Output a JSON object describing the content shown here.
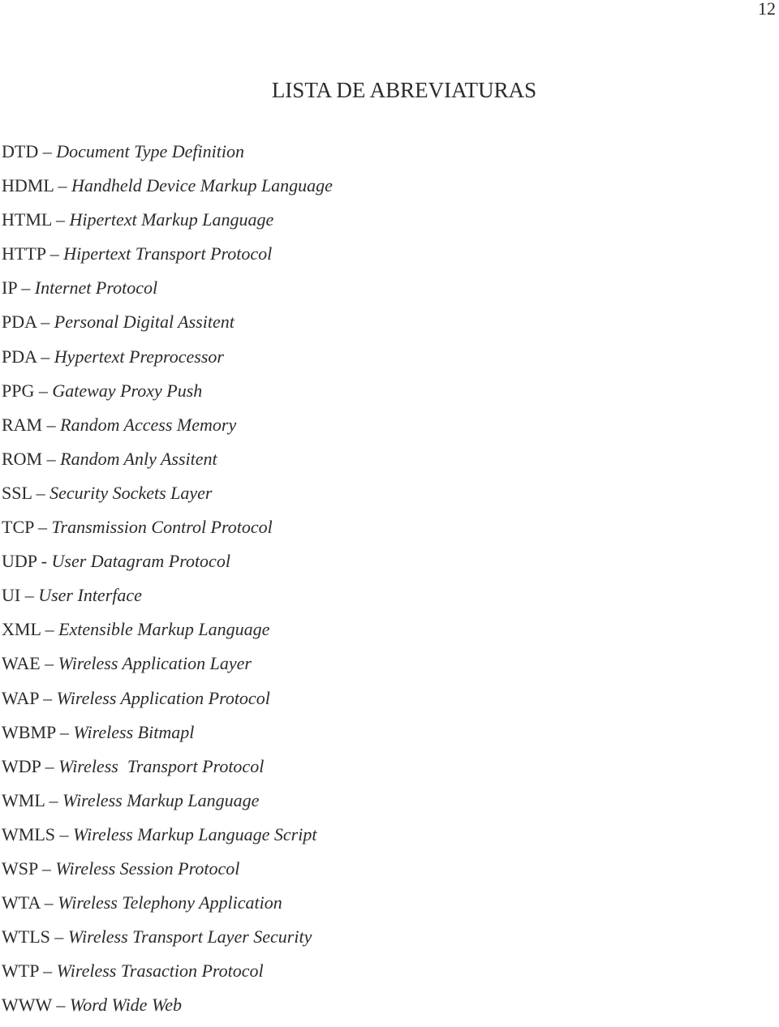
{
  "page": {
    "number": "12",
    "title": "LISTA DE ABREVIATURAS"
  },
  "abbreviations": [
    {
      "term": "DTD",
      "sep": " – ",
      "definition": "Document Type Definition"
    },
    {
      "term": "HDML",
      "sep": " – ",
      "definition": "Handheld Device Markup Language"
    },
    {
      "term": "HTML",
      "sep": " – ",
      "definition": "Hipertext Markup Language"
    },
    {
      "term": "HTTP",
      "sep": " – ",
      "definition": "Hipertext Transport Protocol"
    },
    {
      "term": "IP",
      "sep": " – ",
      "definition": "Internet Protocol"
    },
    {
      "term": "PDA",
      "sep": " – ",
      "definition": "Personal Digital Assitent"
    },
    {
      "term": "PDA",
      "sep": " – ",
      "definition": "Hypertext Preprocessor"
    },
    {
      "term": "PPG",
      "sep": " – ",
      "definition": "Gateway Proxy Push"
    },
    {
      "term": "RAM",
      "sep": " – ",
      "definition": "Random Access Memory"
    },
    {
      "term": "ROM",
      "sep": " – ",
      "definition": "Random Anly Assitent"
    },
    {
      "term": "SSL",
      "sep": " – ",
      "definition": "Security Sockets Layer"
    },
    {
      "term": "TCP",
      "sep": " – ",
      "definition": "Transmission Control Protocol"
    },
    {
      "term": "UDP",
      "sep": " - ",
      "definition": "User Datagram Protocol"
    },
    {
      "term": "UI",
      "sep": " – ",
      "definition": "User Interface"
    },
    {
      "term": "XML",
      "sep": " – ",
      "definition": "Extensible Markup Language"
    },
    {
      "term": "WAE",
      "sep": " – ",
      "definition": "Wireless Application Layer"
    },
    {
      "term": "WAP",
      "sep": " – ",
      "definition": "Wireless Application Protocol"
    },
    {
      "term": "WBMP",
      "sep": " – ",
      "definition": "Wireless Bitmapl"
    },
    {
      "term": "WDP",
      "sep": " – ",
      "definition": "Wireless  Transport Protocol"
    },
    {
      "term": "WML",
      "sep": " – ",
      "definition": "Wireless Markup Language"
    },
    {
      "term": "WMLS",
      "sep": " – ",
      "definition": "Wireless Markup Language Script"
    },
    {
      "term": "WSP",
      "sep": " – ",
      "definition": "Wireless Session Protocol"
    },
    {
      "term": "WTA",
      "sep": " – ",
      "definition": "Wireless Telephony Application"
    },
    {
      "term": "WTLS",
      "sep": " – ",
      "definition": "Wireless Transport Layer Security"
    },
    {
      "term": "WTP",
      "sep": " – ",
      "definition": "Wireless Trasaction Protocol"
    },
    {
      "term": "WWW",
      "sep": " – ",
      "definition": "Word Wide Web"
    }
  ]
}
